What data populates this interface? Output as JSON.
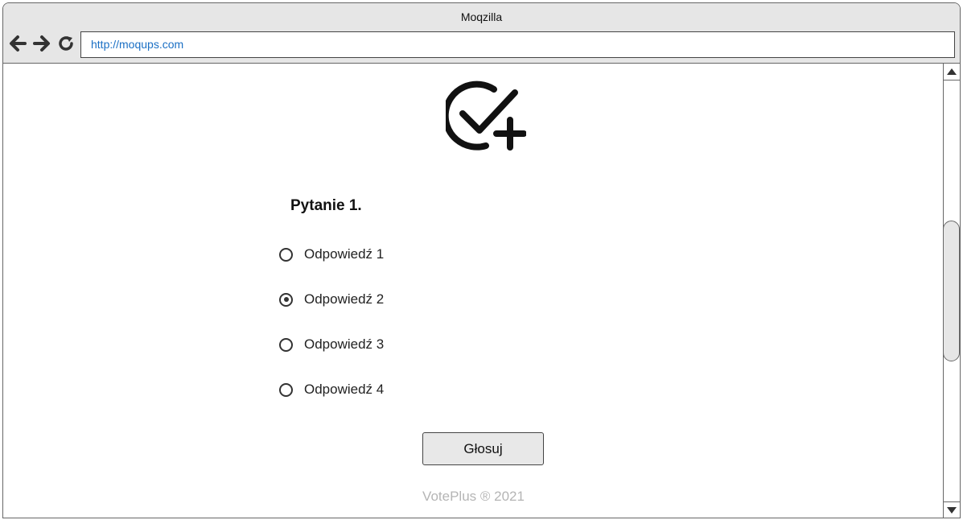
{
  "window": {
    "title": "Moqzilla"
  },
  "toolbar": {
    "back_icon": "arrow-left-icon",
    "forward_icon": "arrow-right-icon",
    "reload_icon": "reload-icon",
    "url": "http://moqups.com"
  },
  "page": {
    "logo_icon": "check-circle-plus-icon",
    "question": "Pytanie 1.",
    "options": [
      {
        "label": "Odpowiedź 1",
        "selected": false
      },
      {
        "label": "Odpowiedź 2",
        "selected": true
      },
      {
        "label": "Odpowiedź 3",
        "selected": false
      },
      {
        "label": "Odpowiedź 4",
        "selected": false
      }
    ],
    "vote_label": "Głosuj",
    "footer": "VotePlus ® 2021"
  },
  "colors": {
    "chrome_bg": "#e6e6e6",
    "link": "#1a6fc4",
    "footer_text": "#b5b5b5"
  }
}
